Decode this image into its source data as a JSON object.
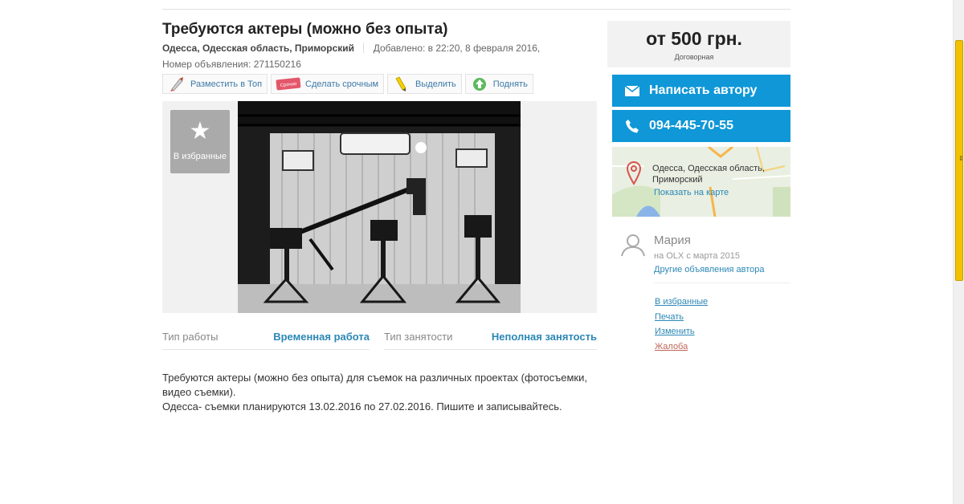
{
  "listing": {
    "title": "Требуются актеры (можно без опыта)",
    "location": "Одесса, Одесская область, Приморский",
    "added": "Добавлено: в 22:20, 8 февраля 2016,",
    "ad_number": "Номер объявления: 271150216"
  },
  "actions": [
    {
      "label": "Разместить в Топ",
      "icon": "rocket-icon"
    },
    {
      "label": "Сделать срочным",
      "icon": "urgent-tag-icon",
      "badge": "Срочно"
    },
    {
      "label": "Выделить",
      "icon": "highlighter-icon"
    },
    {
      "label": "Поднять",
      "icon": "raise-arrow-icon"
    }
  ],
  "gallery": {
    "favorite_label": "В избранные",
    "photo_subject": "tv-studio-cameras"
  },
  "params": [
    {
      "key": "Тип работы",
      "value": "Временная работа"
    },
    {
      "key": "Тип занятости",
      "value": "Неполная занятость"
    }
  ],
  "description": [
    "Требуются актеры (можно без опыта) для съемок на различных проектах (фотосъемки, видео съемки).",
    "Одесса- съемки планируются 13.02.2016 по 27.02.2016. Пишите и записывайтесь."
  ],
  "price": {
    "amount": "от 500 грн.",
    "note": "Договорная"
  },
  "contact": {
    "message_button": "Написать автору",
    "phone": "094-445-70-55"
  },
  "map": {
    "address": "Одесса, Одесская область, Приморский",
    "address_line1": "Одесса, Одесская область,",
    "address_line2": "Приморский",
    "show_link": "Показать на карте"
  },
  "seller": {
    "name": "Мария",
    "since": "на OLX с марта 2015",
    "other_ads": "Другие объявления автора"
  },
  "side_links": [
    {
      "label": "В избранные"
    },
    {
      "label": "Печать"
    },
    {
      "label": "Изменить"
    },
    {
      "label": "Жалоба"
    }
  ],
  "colors": {
    "accent": "#0f97d7",
    "link": "#2b87b5",
    "complaint": "#c0665a",
    "scroll_thumb": "#f2c200"
  }
}
